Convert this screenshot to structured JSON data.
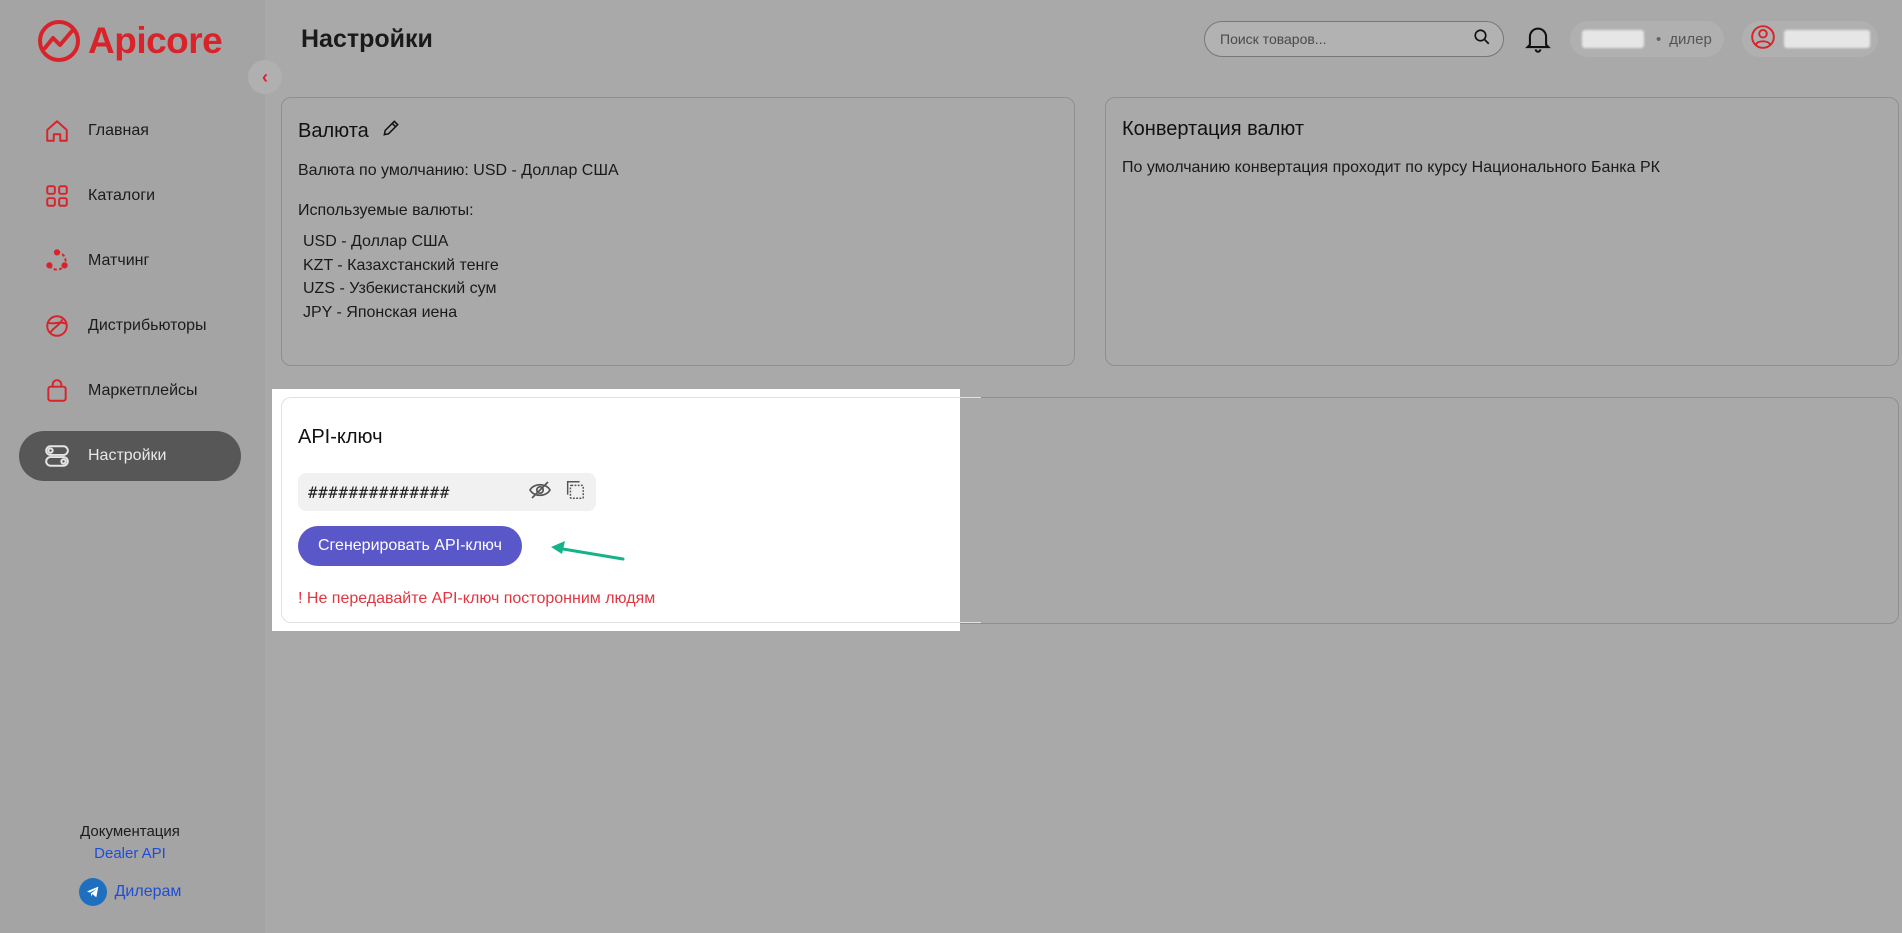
{
  "app": {
    "brand": "Apicore",
    "brand_color": "#d8232a"
  },
  "sidebar": {
    "items": [
      {
        "label": "Главная",
        "icon": "home-icon"
      },
      {
        "label": "Каталоги",
        "icon": "grid-icon"
      },
      {
        "label": "Матчинг",
        "icon": "matching-icon"
      },
      {
        "label": "Дистрибьюторы",
        "icon": "globe-icon"
      },
      {
        "label": "Маркетплейсы",
        "icon": "bag-icon"
      },
      {
        "label": "Настройки",
        "icon": "settings-toggle-icon",
        "active": true
      }
    ],
    "footer": {
      "doc_title": "Документация",
      "doc_link": "Dealer API",
      "telegram_label": "Дилерам"
    }
  },
  "header": {
    "title": "Настройки",
    "search_placeholder": "Поиск товаров...",
    "role": "дилер"
  },
  "currency_card": {
    "title": "Валюта",
    "default_currency": "Валюта по умолчанию: USD - Доллар США",
    "used_title": "Используемые валюты:",
    "currencies": [
      "USD - Доллар США",
      "KZT - Казахстанский тенге",
      "UZS - Узбекистанский сум",
      "JPY - Японская иена"
    ]
  },
  "conversion_card": {
    "title": "Конвертация валют",
    "text": "По умолчанию конвертация проходит по курсу Национального Банка РК"
  },
  "api_card": {
    "title": "API-ключ",
    "key_value": "##############",
    "generate_label": "Сгенерировать API-ключ",
    "warning": "! Не передавайте API-ключ посторонним людям",
    "button_color": "#5a57c9",
    "warning_color": "#e2353f",
    "arrow_color": "#14b38a"
  }
}
